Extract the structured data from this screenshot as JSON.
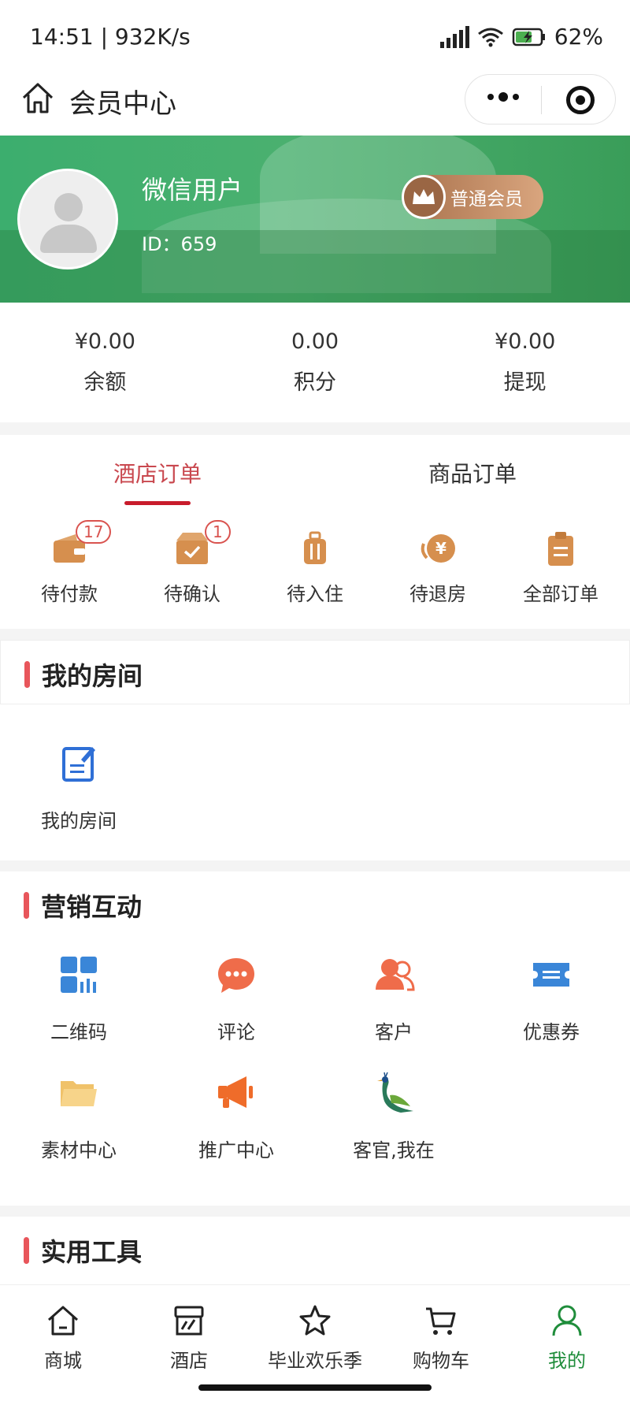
{
  "status_bar": {
    "time_speed": "14:51 | 932K/s",
    "battery": "62%"
  },
  "nav": {
    "title": "会员中心"
  },
  "profile": {
    "name": "微信用户",
    "id": "ID：659",
    "level": "普通会员"
  },
  "stats": [
    {
      "value": "¥0.00",
      "label": "余额"
    },
    {
      "value": "0.00",
      "label": "积分"
    },
    {
      "value": "¥0.00",
      "label": "提现"
    }
  ],
  "order_tabs": [
    {
      "label": "酒店订单",
      "active": true
    },
    {
      "label": "商品订单",
      "active": false
    }
  ],
  "order_items": [
    {
      "label": "待付款",
      "count": "17",
      "icon": "wallet-icon"
    },
    {
      "label": "待确认",
      "count": "1",
      "icon": "check-box-icon"
    },
    {
      "label": "待入住",
      "count": "",
      "icon": "luggage-icon"
    },
    {
      "label": "待退房",
      "count": "",
      "icon": "yen-coin-icon"
    },
    {
      "label": "全部订单",
      "count": "",
      "icon": "clipboard-icon"
    }
  ],
  "my_room": {
    "title": "我的房间",
    "items": [
      {
        "label": "我的房间",
        "icon": "edit-note-icon"
      }
    ]
  },
  "marketing": {
    "title": "营销互动",
    "items": [
      {
        "label": "二维码",
        "icon": "qrcode-icon"
      },
      {
        "label": "评论",
        "icon": "comment-icon"
      },
      {
        "label": "客户",
        "icon": "customer-icon"
      },
      {
        "label": "优惠券",
        "icon": "coupon-icon"
      },
      {
        "label": "素材中心",
        "icon": "folder-icon"
      },
      {
        "label": "推广中心",
        "icon": "megaphone-icon"
      },
      {
        "label": "客官,我在",
        "icon": "peacock-icon"
      }
    ]
  },
  "tools": {
    "title": "实用工具"
  },
  "tabbar": [
    {
      "label": "商城",
      "icon": "home-icon",
      "active": false
    },
    {
      "label": "酒店",
      "icon": "hotel-store-icon",
      "active": false
    },
    {
      "label": "毕业欢乐季",
      "icon": "star-icon",
      "active": false
    },
    {
      "label": "购物车",
      "icon": "cart-icon",
      "active": false
    },
    {
      "label": "我的",
      "icon": "person-icon",
      "active": true
    }
  ],
  "colors": {
    "accent_red": "#c81b2b",
    "active_green": "#1f8d3b",
    "order_icon": "#d68f4e"
  }
}
